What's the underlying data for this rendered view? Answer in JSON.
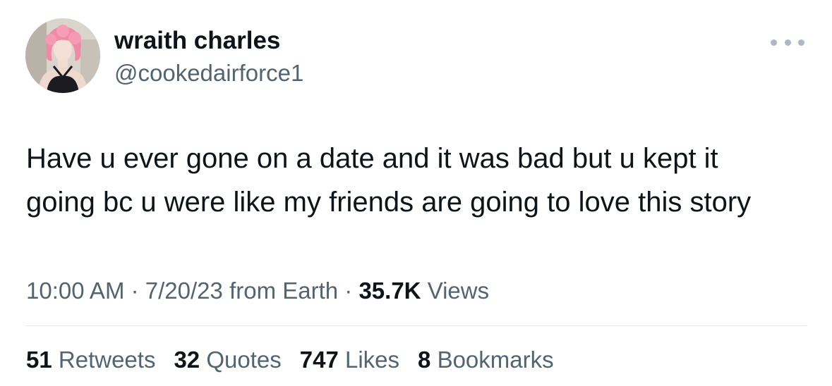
{
  "tweet": {
    "author": {
      "display_name": "wraith charles",
      "handle": "@cookedairforce1"
    },
    "text_lines": [
      "Have u ever gone on a date and it was bad but u kept it",
      "going bc u were like my friends are going to love this story"
    ],
    "time": "10:00 AM",
    "date": "7/20/23",
    "source": "from Earth",
    "separator": "·",
    "views_count": "35.7K",
    "views_label": "Views",
    "stats": [
      {
        "count": "51",
        "label": "Retweets"
      },
      {
        "count": "32",
        "label": "Quotes"
      },
      {
        "count": "747",
        "label": "Likes"
      },
      {
        "count": "8",
        "label": "Bookmarks"
      }
    ]
  },
  "icons": {
    "avatar": "profile-photo",
    "more": "more-horizontal-icon"
  },
  "colors": {
    "primary_text": "#0f1419",
    "secondary_text": "#536471",
    "divider": "#e1e6ea",
    "more_dots": "#b0b8bf"
  }
}
